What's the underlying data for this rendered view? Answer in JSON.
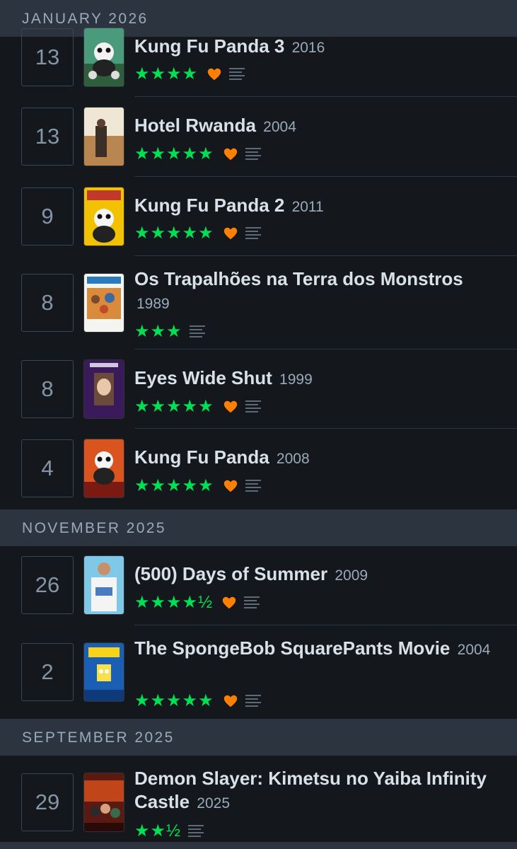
{
  "sections": [
    {
      "label": "JANUARY 2026"
    },
    {
      "label": "NOVEMBER 2025"
    },
    {
      "label": "SEPTEMBER 2025"
    }
  ],
  "entries": [
    {
      "day": "13",
      "title": "Kung Fu Panda 3",
      "year": "2016",
      "stars": "★★★★",
      "liked": true
    },
    {
      "day": "13",
      "title": "Hotel Rwanda",
      "year": "2004",
      "stars": "★★★★★",
      "liked": true
    },
    {
      "day": "9",
      "title": "Kung Fu Panda 2",
      "year": "2011",
      "stars": "★★★★★",
      "liked": true
    },
    {
      "day": "8",
      "title": "Os Trapalhões na Terra dos Monstros",
      "year": "1989",
      "stars": "★★★",
      "liked": false
    },
    {
      "day": "8",
      "title": "Eyes Wide Shut",
      "year": "1999",
      "stars": "★★★★★",
      "liked": true
    },
    {
      "day": "4",
      "title": "Kung Fu Panda",
      "year": "2008",
      "stars": "★★★★★",
      "liked": true
    },
    {
      "day": "26",
      "title": "(500) Days of Summer",
      "year": "2009",
      "stars": "★★★★½",
      "liked": true
    },
    {
      "day": "2",
      "title": "The SpongeBob SquarePants Movie",
      "year": "2004",
      "stars": "★★★★★",
      "liked": true
    },
    {
      "day": "29",
      "title": "Demon Slayer: Kimetsu no Yaiba Infinity Castle",
      "year": "2025",
      "stars": "★★½",
      "liked": false
    }
  ],
  "colors": {
    "star": "#00e054",
    "heart": "#ff8000",
    "header_bg": "#2c3440",
    "bg": "#14181c"
  },
  "icons": {
    "like": "heart-icon",
    "review": "review-lines-icon"
  }
}
